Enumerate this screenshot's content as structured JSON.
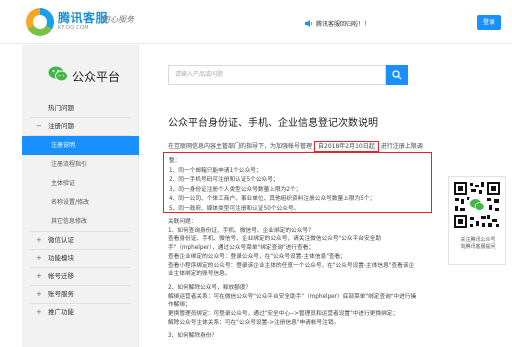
{
  "header": {
    "logo_text": "腾讯客服",
    "logo_url": "KF.QQ.COM",
    "slogan": "用心服务",
    "notice": "腾讯客服回归啦！！",
    "login_label": "登录",
    "accent": "#1890ff"
  },
  "sidebar": {
    "brand_label": "公众平台",
    "brand_icon": "wechat-icon",
    "items": [
      {
        "label": "热门问题",
        "sym": ""
      },
      {
        "label": "注册问题",
        "sym": "−"
      }
    ],
    "sub_items": [
      {
        "label": "注册说明"
      },
      {
        "label": "注册流程指引"
      },
      {
        "label": "主体验证"
      },
      {
        "label": "名称设置/修改"
      },
      {
        "label": "其它信息修改"
      }
    ],
    "groups": [
      {
        "label": "微信认证",
        "sym": "+"
      },
      {
        "label": "功能模块",
        "sym": "+"
      },
      {
        "label": "帐号迁移",
        "sym": "+"
      },
      {
        "label": "账号服务",
        "sym": "+"
      },
      {
        "label": "推广功能",
        "sym": "+"
      }
    ]
  },
  "search": {
    "placeholder": "请输入产品或问题"
  },
  "article": {
    "title": "公众平台身份证、手机、企业信息登记次数说明",
    "intro_before": "在互联网信息内容主管部门的指导下，为加强帐号管理",
    "intro_date": "自2018年2月10日起",
    "intro_after": "进行注册上限调",
    "intro_cont": "整：",
    "rules": [
      "1、同一个邮箱只能申请1个公众号；",
      "2、同一手机号码可注册和认证5个公众号；",
      "3、同一身份证注册个人类型公众号数量上限为2个；",
      "4、同一公司、个体工商户、事业单位、其他组织资料注册公众号数量上限为5个；",
      "5、同一政府、媒体类型可注册和认证50个公众号。"
    ],
    "body": [
      "关联问题：",
      "1、如何查询身份证、手机、微信号、企业绑定的公众号？",
      "查看身份证、手机、微信号、企业绑定的公众号，请关注微信公众号\"公众平台安全助",
      "手\"（mphelper），通过公众号菜单\"绑定查询\"进行查看；",
      "查看企业绑定的公众号：登录公众号，在\"公众号设置-主体信息\"查看；",
      "查看小程序绑定的公众号：登录该企业主体的任意一个公众号，在\"公众号设置-主体信息\"查看该企",
      "业主体绑定的账号信息。",
      "",
      "2、如何解除公众号，释放额度？",
      "解绑运营者关系：可在微信公众号\"公众平台安全助手\"（mphelper）底部菜单\"绑定查询\"中进行操",
      "作解绑；",
      "更换管理员绑定：可登录公众号，通过\"安全中心-->管理员和运营者设置\"中进行更换绑定；",
      "解除公众号主体关系：可在\"公众号设置->注册信息\"申请帐号注销。",
      "",
      "3、如何解除身份？"
    ]
  },
  "qr_card": {
    "caption_line1": "关注腾讯公众号",
    "caption_line2": "向腾讯客服提问"
  }
}
